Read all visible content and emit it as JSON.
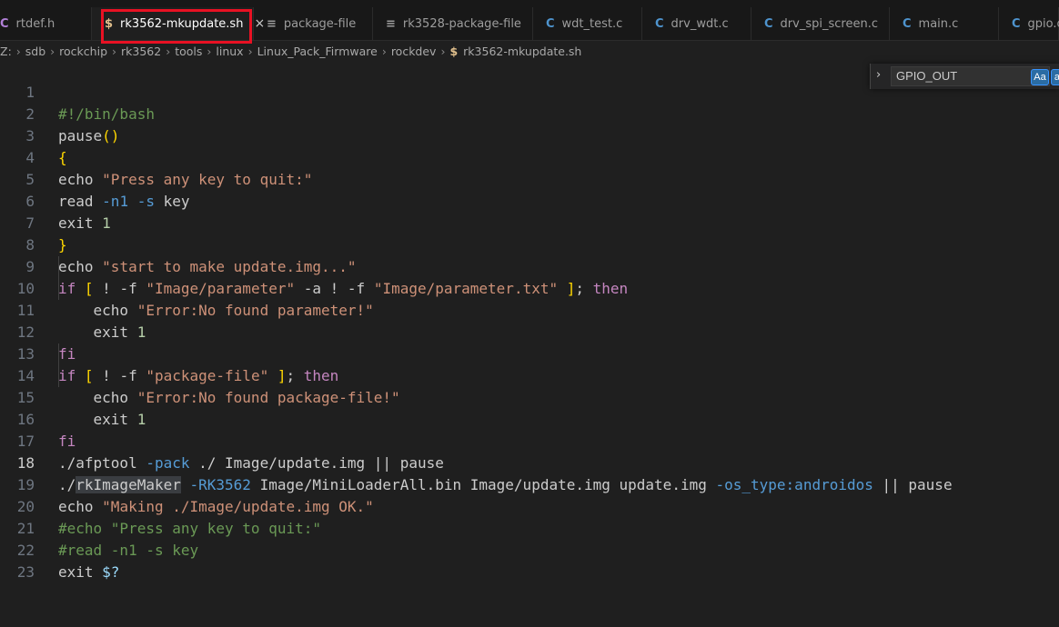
{
  "tabs": [
    {
      "label": "rtdef.h",
      "icon": "c-header-icon",
      "glyph": "C"
    },
    {
      "label": "rk3562-mkupdate.sh",
      "icon": "shell-icon",
      "glyph": "$"
    },
    {
      "label": "package-file",
      "icon": "file-lines-icon",
      "glyph": "≡"
    },
    {
      "label": "rk3528-package-file",
      "icon": "file-lines-icon",
      "glyph": "≡"
    },
    {
      "label": "wdt_test.c",
      "icon": "c-file-icon",
      "glyph": "C"
    },
    {
      "label": "drv_wdt.c",
      "icon": "c-file-icon",
      "glyph": "C"
    },
    {
      "label": "drv_spi_screen.c",
      "icon": "c-file-icon",
      "glyph": "C"
    },
    {
      "label": "main.c",
      "icon": "c-file-icon",
      "glyph": "C"
    },
    {
      "label": "gpio.c",
      "icon": "c-file-icon",
      "glyph": "C"
    }
  ],
  "active_tab_close": "×",
  "breadcrumbs": [
    "Z:",
    "sdb",
    "rockchip",
    "rk3562",
    "tools",
    "linux",
    "Linux_Pack_Firmware",
    "rockdev"
  ],
  "breadcrumb_sep": "›",
  "breadcrumb_file": {
    "glyph": "$",
    "label": "rk3562-mkupdate.sh"
  },
  "find": {
    "toggle": "›",
    "value": "GPIO_OUT",
    "match_case": "Aa",
    "match_word": "ab"
  },
  "editor": {
    "current_line": 18,
    "lines": [
      {
        "n": "1",
        "code": "#!/bin/bash"
      },
      {
        "n": "2",
        "code": "pause()"
      },
      {
        "n": "3",
        "code": "{"
      },
      {
        "n": "4",
        "code": "echo \"Press any key to quit:\""
      },
      {
        "n": "5",
        "code": "read -n1 -s key"
      },
      {
        "n": "6",
        "code": "exit 1"
      },
      {
        "n": "7",
        "code": "}"
      },
      {
        "n": "8",
        "code": "echo \"start to make update.img...\""
      },
      {
        "n": "9",
        "code": "if [ ! -f \"Image/parameter\" -a ! -f \"Image/parameter.txt\" ]; then"
      },
      {
        "n": "10",
        "code": "    echo \"Error:No found parameter!\""
      },
      {
        "n": "11",
        "code": "    exit 1"
      },
      {
        "n": "12",
        "code": "fi"
      },
      {
        "n": "13",
        "code": "if [ ! -f \"package-file\" ]; then"
      },
      {
        "n": "14",
        "code": "    echo \"Error:No found package-file!\""
      },
      {
        "n": "15",
        "code": "    exit 1"
      },
      {
        "n": "16",
        "code": "fi"
      },
      {
        "n": "17",
        "code": "./afptool -pack ./ Image/update.img || pause"
      },
      {
        "n": "18",
        "code": "./rkImageMaker -RK3562 Image/MiniLoaderAll.bin Image/update.img update.img -os_type:androidos || pause"
      },
      {
        "n": "19",
        "code": "echo \"Making ./Image/update.img OK.\""
      },
      {
        "n": "20",
        "code": "#echo \"Press any key to quit:\""
      },
      {
        "n": "21",
        "code": "#read -n1 -s key"
      },
      {
        "n": "22",
        "code": "exit $?"
      },
      {
        "n": "23",
        "code": ""
      }
    ]
  },
  "colors": {
    "background": "#1f1f1f",
    "string": "#ce9178",
    "keyword": "#c586c0",
    "comment": "#6a9955",
    "flag": "#569cd6",
    "highlight_box": "#e81123"
  }
}
